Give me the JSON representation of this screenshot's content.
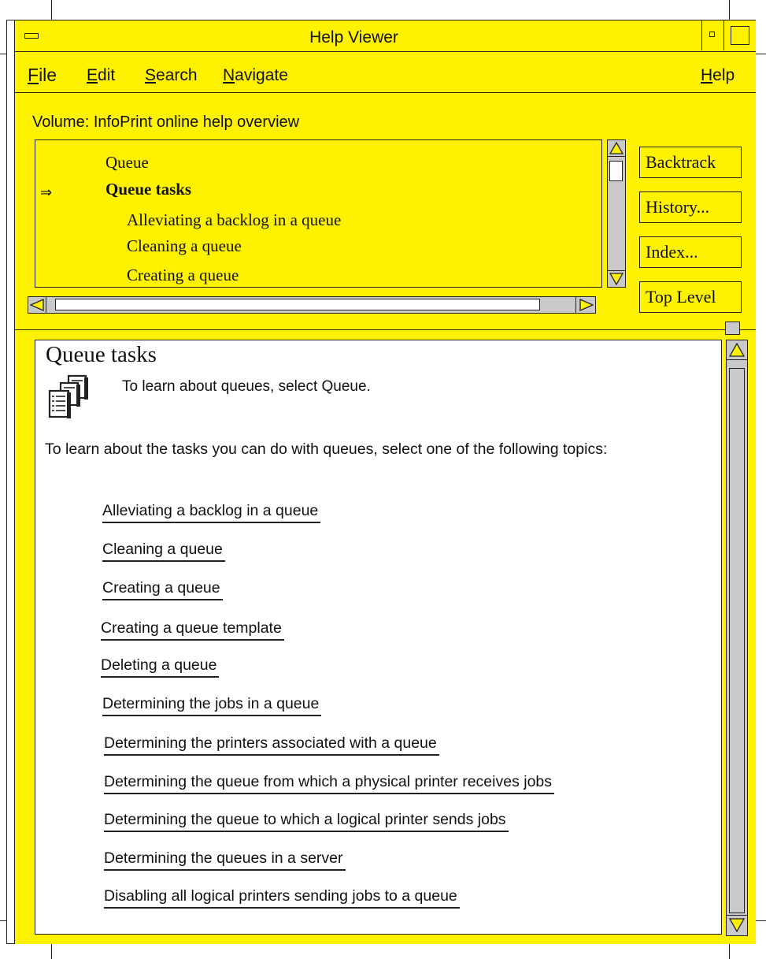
{
  "window": {
    "title": "Help Viewer"
  },
  "menubar": {
    "items": [
      "File",
      "Edit",
      "Search",
      "Navigate"
    ],
    "help": "Help"
  },
  "volume": {
    "label": "Volume:  InfoPrint online help overview"
  },
  "tree": {
    "selected_marker": "⇒",
    "items": [
      "Queue",
      "Queue tasks",
      "Alleviating a backlog in a queue",
      "Cleaning a queue",
      "Creating a queue"
    ]
  },
  "buttons": {
    "backtrack": "Backtrack",
    "history": "History...",
    "index": "Index...",
    "top_level": "Top Level"
  },
  "content": {
    "title": "Queue tasks",
    "intro": "To learn about queues, select Queue.",
    "paragraph": "To learn about the tasks you can do with queues, select one of the following topics:",
    "links": [
      "Alleviating a backlog in a queue",
      "Cleaning a queue",
      "Creating a queue",
      "Creating a queue template",
      "Deleting a queue",
      "Determining the jobs in a queue",
      "Determining the printers associated with a queue",
      "Determining the queue from which a physical printer receives jobs",
      "Determining the queue to which a logical printer sends jobs",
      "Determining the queues in a server",
      "Disabling all logical printers sending jobs to a queue"
    ]
  },
  "colors": {
    "background": "#fff200",
    "scrollbar": "#c9c9c9",
    "content_bg": "#ffffff"
  }
}
